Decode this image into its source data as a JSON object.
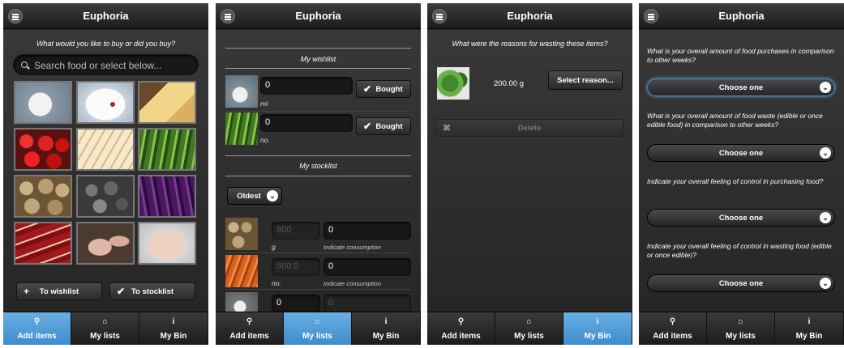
{
  "app_title": "Euphoria",
  "tabs": [
    {
      "label": "Add items",
      "icon": "search-icon"
    },
    {
      "label": "My lists",
      "icon": "home-icon"
    },
    {
      "label": "My Bin",
      "icon": "info-icon"
    }
  ],
  "screen1": {
    "prompt": "What would you like to buy or did you buy?",
    "search_placeholder": "Search food or select below...",
    "food_grid": [
      "milk",
      "yogurt",
      "cheese",
      "tomatoes",
      "bread",
      "cucumbers",
      "potatoes",
      "mushrooms",
      "aubergines",
      "steak",
      "chicken",
      "chicken breast"
    ],
    "to_wishlist_label": "To wishlist",
    "to_stocklist_label": "To stocklist"
  },
  "screen2": {
    "wishlist_title": "My wishlist",
    "wishlist": [
      {
        "value": "0",
        "unit": "ml",
        "button": "Bought"
      },
      {
        "value": "0",
        "unit": "no.",
        "button": "Bought"
      }
    ],
    "stocklist_title": "My stocklist",
    "sort_label": "Oldest",
    "stocklist": [
      {
        "amount": "800",
        "consumed": "0",
        "unit": "g",
        "hint": "Indicate consumption"
      },
      {
        "amount": "500.0",
        "consumed": "0",
        "unit": "no.",
        "hint": "Indicate consumption"
      },
      {
        "amount": "0",
        "consumed": "0"
      }
    ]
  },
  "screen3": {
    "prompt": "What were the reasons for wasting these items?",
    "item_amount": "200.00 g",
    "reason_button": "Select reason...",
    "delete_label": "Delete"
  },
  "screen4": {
    "questions": [
      {
        "text": "What is your overall amount of food purchases in comparison to other weeks?",
        "choice": "Choose one"
      },
      {
        "text": "What is your overall amount of food waste (edible or once edible food) in comparison to other weeks?",
        "choice": "Choose one"
      },
      {
        "text": "Indicate your overall feeling of control in purchasing food?",
        "choice": "Choose one"
      },
      {
        "text": "Indicate your overall feeling of control in wasting food (edible or once edible)?",
        "choice": "Choose one"
      }
    ]
  },
  "active_tabs": [
    "Add items",
    "My lists",
    "My Bin",
    "none"
  ],
  "colors": {
    "active_tab": "#4f9ad6",
    "background": "#2b2b2b"
  }
}
